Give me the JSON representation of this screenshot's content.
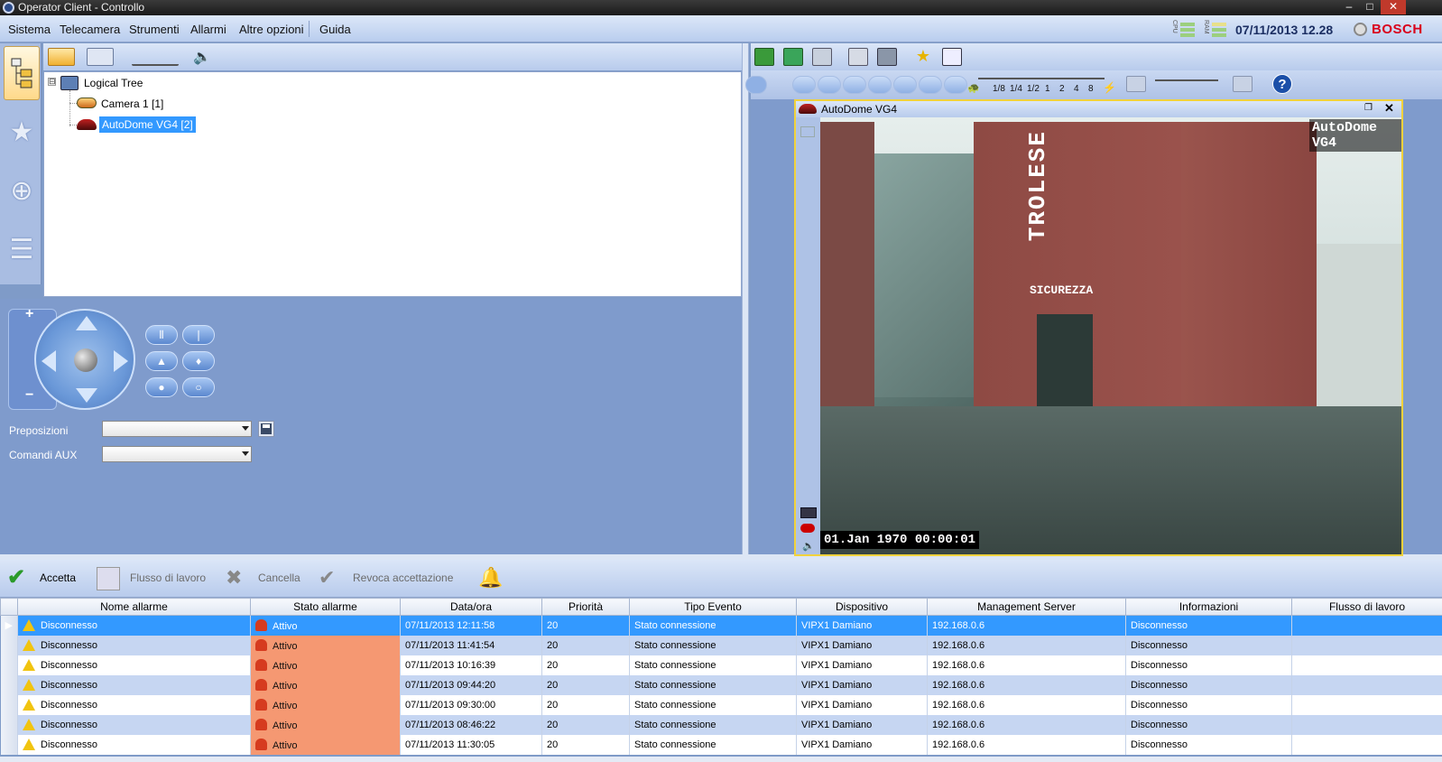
{
  "window": {
    "title": "Operator Client - Controllo"
  },
  "menu": {
    "items": [
      "Sistema",
      "Telecamera",
      "Strumenti",
      "Allarmi",
      "Altre opzioni",
      "Guida"
    ]
  },
  "status": {
    "cpu_label": "CPU",
    "ram_label": "RAM",
    "datetime": "07/11/2013 12.28",
    "brand": "BOSCH"
  },
  "tree": {
    "root": "Logical Tree",
    "children": [
      "Camera 1 [1]",
      "AutoDome VG4 [2]"
    ],
    "expander_symbol": "⊟"
  },
  "ptz": {
    "zoom_in": "+",
    "zoom_out": "−",
    "preset_label": "Preposizioni",
    "aux_label": "Comandi AUX",
    "preset_value": "",
    "aux_value": ""
  },
  "playback": {
    "speed_labels": [
      "1/8",
      "1/4",
      "1/2",
      "1",
      "2",
      "4",
      "8"
    ],
    "help_symbol": "?"
  },
  "video": {
    "title": "AutoDome VG4",
    "overlay_camera": "AutoDome VG4",
    "overlay_timestamp": "01.Jan 1970  00:00:01",
    "sign_text": "TROLESE",
    "sign_text2": "SICUREZZA"
  },
  "alarm_toolbar": {
    "accept": "Accetta",
    "workflow": "Flusso di lavoro",
    "clear": "Cancella",
    "revoke": "Revoca accettazione"
  },
  "alarm_table": {
    "columns": [
      "Nome allarme",
      "Stato allarme",
      "Data/ora",
      "Priorità",
      "Tipo Evento",
      "Dispositivo",
      "Management Server",
      "Informazioni",
      "Flusso di lavoro"
    ],
    "rows": [
      {
        "name": "Disconnesso",
        "state": "Attivo",
        "datetime": "07/11/2013 12:11:58",
        "priority": "20",
        "event": "Stato connessione",
        "device": "VIPX1 Damiano",
        "server": "192.168.0.6",
        "info": "Disconnesso",
        "workflow": ""
      },
      {
        "name": "Disconnesso",
        "state": "Attivo",
        "datetime": "07/11/2013 11:41:54",
        "priority": "20",
        "event": "Stato connessione",
        "device": "VIPX1 Damiano",
        "server": "192.168.0.6",
        "info": "Disconnesso",
        "workflow": ""
      },
      {
        "name": "Disconnesso",
        "state": "Attivo",
        "datetime": "07/11/2013 10:16:39",
        "priority": "20",
        "event": "Stato connessione",
        "device": "VIPX1 Damiano",
        "server": "192.168.0.6",
        "info": "Disconnesso",
        "workflow": ""
      },
      {
        "name": "Disconnesso",
        "state": "Attivo",
        "datetime": "07/11/2013 09:44:20",
        "priority": "20",
        "event": "Stato connessione",
        "device": "VIPX1 Damiano",
        "server": "192.168.0.6",
        "info": "Disconnesso",
        "workflow": ""
      },
      {
        "name": "Disconnesso",
        "state": "Attivo",
        "datetime": "07/11/2013 09:30:00",
        "priority": "20",
        "event": "Stato connessione",
        "device": "VIPX1 Damiano",
        "server": "192.168.0.6",
        "info": "Disconnesso",
        "workflow": ""
      },
      {
        "name": "Disconnesso",
        "state": "Attivo",
        "datetime": "07/11/2013 08:46:22",
        "priority": "20",
        "event": "Stato connessione",
        "device": "VIPX1 Damiano",
        "server": "192.168.0.6",
        "info": "Disconnesso",
        "workflow": ""
      },
      {
        "name": "Disconnesso",
        "state": "Attivo",
        "datetime": "07/11/2013 11:30:05",
        "priority": "20",
        "event": "Stato connessione",
        "device": "VIPX1 Damiano",
        "server": "192.168.0.6",
        "info": "Disconnesso",
        "workflow": ""
      }
    ]
  },
  "colors": {
    "accent": "#3399ff",
    "alarm_state": "#f59872",
    "panel": "#7f9bcc",
    "brand": "#d9001b",
    "focus_border": "#f1d23c"
  },
  "icons": {
    "window": [
      "app-icon",
      "minimize-icon",
      "maximize-icon",
      "close-icon"
    ],
    "nav": [
      "tree-icon",
      "favorites-star-icon",
      "ptz-control-icon",
      "alarm-list-icon"
    ],
    "alarm": [
      "warning-icon",
      "alarm-bell-icon"
    ]
  }
}
